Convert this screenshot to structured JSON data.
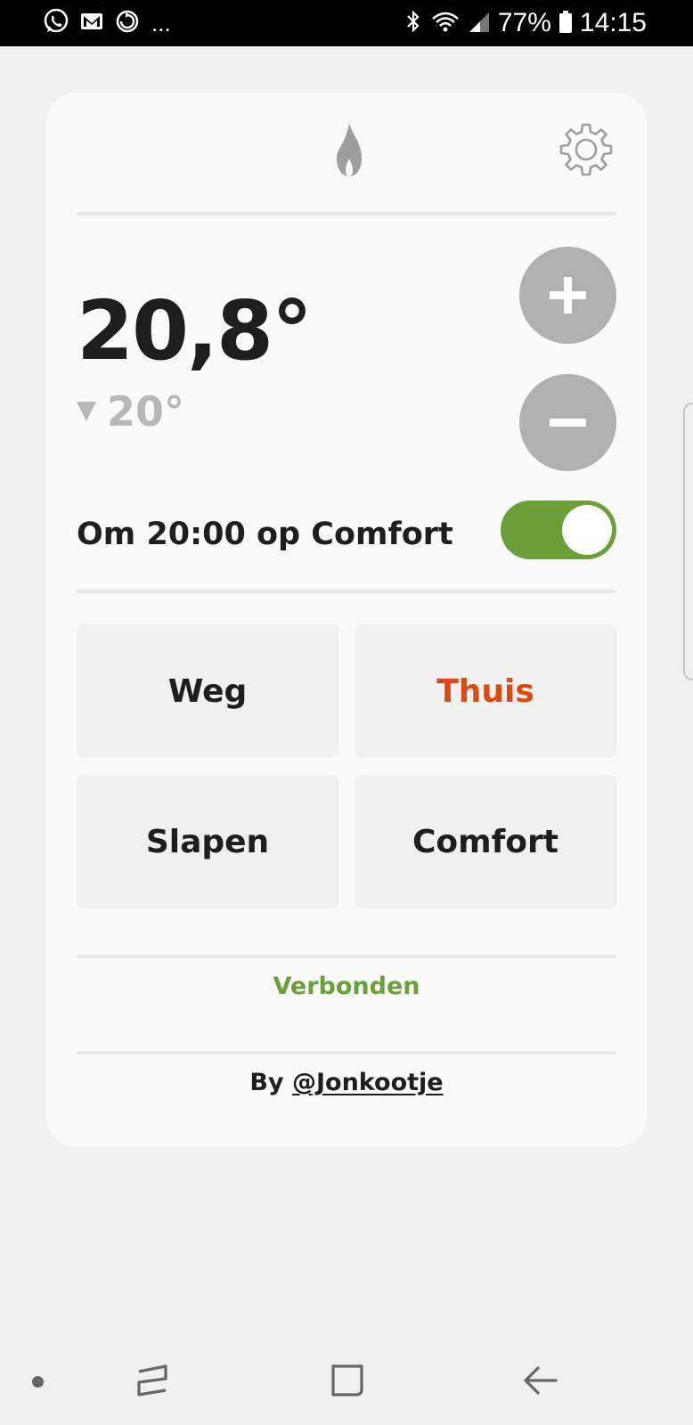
{
  "status_bar": {
    "left_icons": [
      "whatsapp-icon",
      "gmail-icon",
      "sync-icon"
    ],
    "more": "...",
    "battery_percent": "77%",
    "time": "14:15"
  },
  "thermostat": {
    "current_temp": "20,8°",
    "target_temp": "20°",
    "schedule_label": "Om 20:00 op Comfort",
    "schedule_enabled": true,
    "modes": [
      {
        "label": "Weg",
        "active": false
      },
      {
        "label": "Thuis",
        "active": true
      },
      {
        "label": "Slapen",
        "active": false
      },
      {
        "label": "Comfort",
        "active": false
      }
    ],
    "connection_status": "Verbonden",
    "credit_prefix": "By",
    "credit_handle": "@Jonkootje"
  },
  "colors": {
    "accent_green": "#6a9f3a",
    "active_mode": "#d94b12",
    "button_grey": "#b0b0b0"
  }
}
